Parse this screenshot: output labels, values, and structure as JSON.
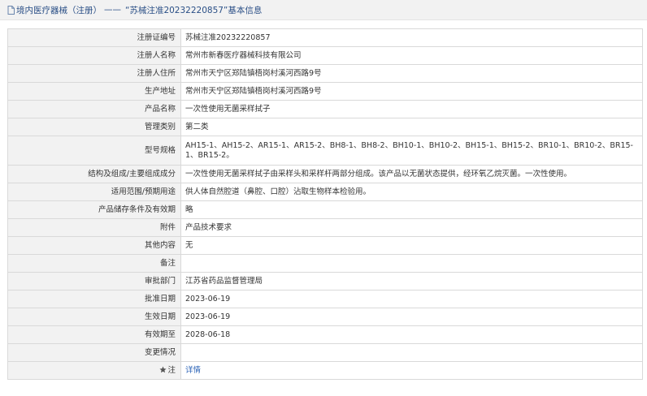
{
  "header": {
    "icon": "document-icon",
    "category": "境内医疗器械（注册）",
    "separator": "——",
    "record_title": "“苏械注准20232220857”基本信息"
  },
  "rows": [
    {
      "label": "注册证编号",
      "value": "苏械注准20232220857"
    },
    {
      "label": "注册人名称",
      "value": "常州市新春医疗器械科技有限公司"
    },
    {
      "label": "注册人住所",
      "value": "常州市天宁区郑陆镇梧岗村溪河西路9号"
    },
    {
      "label": "生产地址",
      "value": "常州市天宁区郑陆镇梧岗村溪河西路9号"
    },
    {
      "label": "产品名称",
      "value": "一次性使用无菌采样拭子"
    },
    {
      "label": "管理类别",
      "value": "第二类"
    },
    {
      "label": "型号规格",
      "value": "AH15-1、AH15-2、AR15-1、AR15-2、BH8-1、BH8-2、BH10-1、BH10-2、BH15-1、BH15-2、BR10-1、BR10-2、BR15-1、BR15-2。"
    },
    {
      "label": "结构及组成/主要组成成分",
      "value": "一次性使用无菌采样拭子由采样头和采样杆两部分组成。该产品以无菌状态提供，经环氧乙烷灭菌。一次性使用。"
    },
    {
      "label": "适用范围/预期用途",
      "value": "供人体自然腔道（鼻腔、口腔）沾取生物样本检验用。"
    },
    {
      "label": "产品储存条件及有效期",
      "value": "略"
    },
    {
      "label": "附件",
      "value": "产品技术要求"
    },
    {
      "label": "其他内容",
      "value": "无"
    },
    {
      "label": "备注",
      "value": ""
    },
    {
      "label": "审批部门",
      "value": "江苏省药品监督管理局"
    },
    {
      "label": "批准日期",
      "value": "2023-06-19"
    },
    {
      "label": "生效日期",
      "value": "2023-06-19"
    },
    {
      "label": "有效期至",
      "value": "2028-06-18"
    },
    {
      "label": "变更情况",
      "value": ""
    }
  ],
  "note_row": {
    "icon": "star-icon",
    "label": "注",
    "link_text": "详情"
  },
  "colors": {
    "label_bg": "#f2f2f2",
    "border": "#d9d9d9",
    "title": "#2a4f86",
    "link": "#2a62b6"
  }
}
